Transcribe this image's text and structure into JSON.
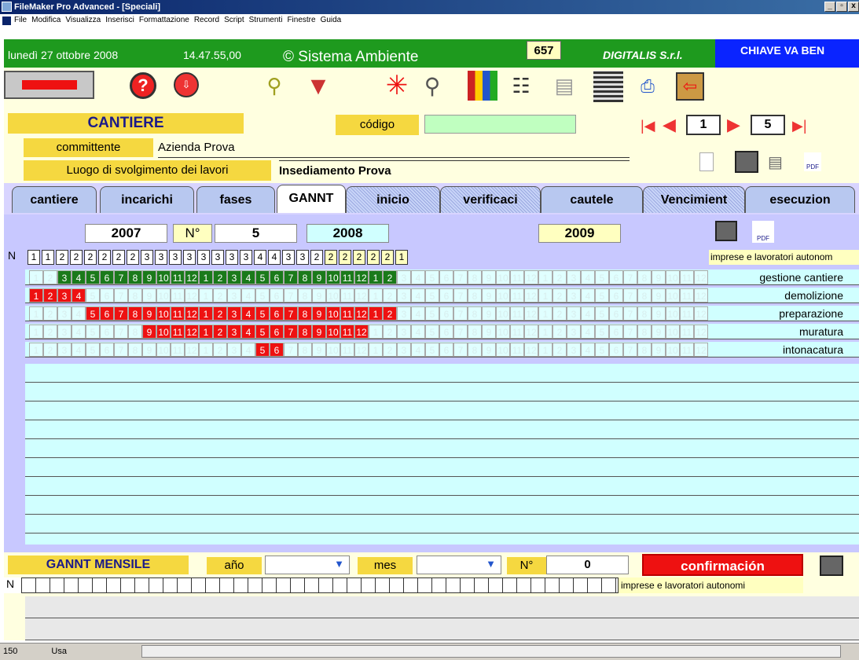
{
  "window": {
    "title": "FileMaker Pro Advanced - [Speciali]"
  },
  "menu": [
    "File",
    "Modifica",
    "Visualizza",
    "Inserisci",
    "Formattazione",
    "Record",
    "Script",
    "Strumenti",
    "Finestre",
    "Guida"
  ],
  "header": {
    "date": "lunedì 27 ottobre 2008",
    "time": "14.47.55,00",
    "system": "© Sistema Ambiente",
    "record_count": "657",
    "company": "DIGITALIS S.r.l.",
    "key": "CHIAVE VA BEN"
  },
  "form": {
    "section": "CANTIERE",
    "code_label": "código",
    "code_value": "",
    "client_label": "committente",
    "client_value": "Azienda Prova",
    "place_label": "Luogo di svolgimento dei lavori",
    "place_value": "Insediamento Prova",
    "record_current": "1",
    "record_total": "5"
  },
  "tabs": [
    "cantiere",
    "incarichi",
    "fases",
    "GANNT",
    "inicio",
    "verificaci",
    "cautele",
    "Vencimient",
    "esecuzion"
  ],
  "gantt": {
    "year1": "2007",
    "n_label": "N°",
    "n_value": "5",
    "year2": "2008",
    "year3": "2009",
    "n_col": "N",
    "counts": [
      "1",
      "1",
      "2",
      "2",
      "2",
      "2",
      "2",
      "2",
      "3",
      "3",
      "3",
      "3",
      "3",
      "3",
      "3",
      "3",
      "4",
      "4",
      "3",
      "3",
      "2",
      "2",
      "2",
      "2",
      "2",
      "2",
      "1"
    ],
    "imprese_label": "imprese e lavoratori autonom",
    "rows": [
      {
        "phase": "gestione cantiere",
        "start": 2,
        "len": 24
      },
      {
        "phase": "demolizione",
        "start": 0,
        "len": 4
      },
      {
        "phase": "preparazione",
        "start": 4,
        "len": 22
      },
      {
        "phase": "muratura",
        "start": 8,
        "len": 16
      },
      {
        "phase": "intonacatura",
        "start": 16,
        "len": 2
      }
    ],
    "row_colors": [
      "#1a7a1a",
      "#ee1111",
      "#ee1111",
      "#ee1111",
      "#ee1111"
    ]
  },
  "monthly": {
    "title": "GANNT MENSILE",
    "year_label": "año",
    "month_label": "mes",
    "n_label": "N°",
    "n_value": "0",
    "confirm": "confirmación",
    "n_col": "N",
    "imprese_label": "imprese e lavoratori autonomi"
  },
  "status": {
    "zoom": "150",
    "mode": "Usa"
  }
}
